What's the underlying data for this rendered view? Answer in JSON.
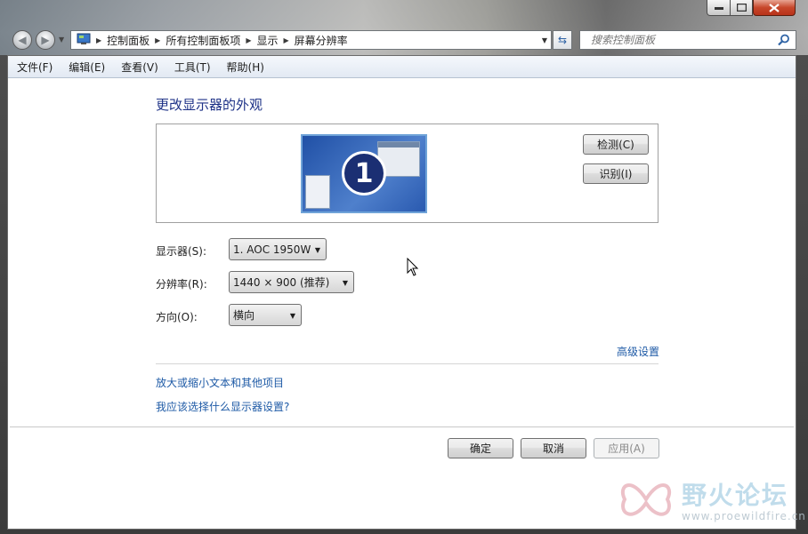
{
  "address": {
    "crumbs": [
      "控制面板",
      "所有控制面板项",
      "显示",
      "屏幕分辨率"
    ]
  },
  "search": {
    "placeholder": "搜索控制面板"
  },
  "menu": [
    "文件(F)",
    "编辑(E)",
    "查看(V)",
    "工具(T)",
    "帮助(H)"
  ],
  "page": {
    "title": "更改显示器的外观",
    "monitor_number": "1",
    "detect_label": "检测(C)",
    "identify_label": "识别(I)"
  },
  "settings": {
    "display_label": "显示器(S):",
    "display_value": "1. AOC 1950W",
    "resolution_label": "分辨率(R):",
    "resolution_value": "1440 × 900 (推荐)",
    "orientation_label": "方向(O):",
    "orientation_value": "横向",
    "advanced_link": "高级设置"
  },
  "links": {
    "text_size": "放大或缩小文本和其他项目",
    "which_settings": "我应该选择什么显示器设置?"
  },
  "footer": {
    "ok": "确定",
    "cancel": "取消",
    "apply": "应用(A)"
  },
  "watermark": {
    "title": "野火论坛",
    "url": "www.proewildfire.cn"
  },
  "colors": {
    "link": "#1e5aa6",
    "heading": "#1e3287",
    "monitor_blue": "#2050a6"
  }
}
